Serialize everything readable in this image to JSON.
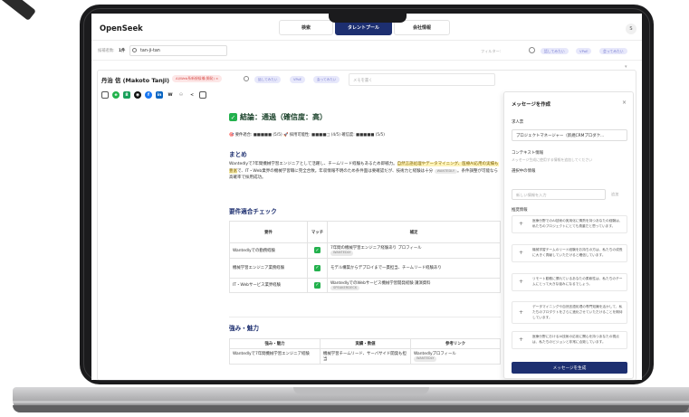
{
  "app": {
    "brand": "OpenSeek",
    "nav_tabs": [
      {
        "label": "検索",
        "active": false
      },
      {
        "label": "タレントプール",
        "active": true
      },
      {
        "label": "会社情報",
        "active": false
      }
    ],
    "avatar_initial": "S"
  },
  "search": {
    "label": "候補者数:",
    "count": "1件",
    "query": "tan-ji-tan",
    "filter_label": "フィルター:",
    "chips": [
      "話してみたい",
      "VPoE",
      "会ってみたい"
    ]
  },
  "candidate": {
    "name": "丹治 信 (Makoto Tanji)",
    "tag": "AI/Web系新規候補(開発) ×",
    "chips": [
      "話してみたい",
      "VPoE",
      "会ってみたい"
    ],
    "memo_placeholder": "メモを書く",
    "social_icons": [
      "chat-icon",
      "lapras-icon",
      "eight-icon",
      "github-icon",
      "facebook-icon",
      "linkedin-icon",
      "wantedly-icon",
      "people-icon",
      "share-icon",
      "archive-icon"
    ]
  },
  "report": {
    "verdict": "結論：通過（確信度：高）",
    "scores": "🎯 要件適合: ■■■■■ (5/5)  🚀 採用可能性: ■■■■□ (4/5) 確信度: ■■■■■ (5/5)",
    "summary_heading": "まとめ",
    "summary_part1": "Wantedlyで7年間機械学習エンジニアとして活躍し、チームリード経験もあるため即戦力。",
    "summary_highlight": "自然言語処理やデータマイニング、医療AI応用の実績も豊富",
    "summary_part2": "で、IT・Web業界の機械学習職に完全合致。年収情報不明のため条件面は要確認だが、技術力と経験は十分",
    "summary_pill": "WANTEDLY",
    "summary_part3": "。条件調整が可能なら高確率で採用成功。",
    "req_heading": "要件適合チェック",
    "req_columns": [
      "要件",
      "マッチ",
      "補足"
    ],
    "req_rows": [
      {
        "req": "Wantedlyでの勤務経験",
        "note": "7年間の機械学習エンジニア経験あり プロフィール",
        "pill": "WANTEDLY"
      },
      {
        "req": "機械学習エンジニア業務経験",
        "note": "モデル構築からデプロイまで一貫担当、チームリード経験あり",
        "pill": ""
      },
      {
        "req": "IT・Webサービス業界経験",
        "note": "WantedlyでのWebサービス機械学習開発経験 講演資料",
        "pill": "SPEAKERDECK"
      }
    ],
    "strengths_heading": "強み・魅力",
    "str_columns": [
      "強み・魅力",
      "実績・数値",
      "参考リンク"
    ],
    "str_rows": [
      {
        "strength": "Wantedlyで7年間機械学習エンジニア経験",
        "result": "機械学習チームリード、サーバサイド開発も担当",
        "link": "Wantedlyプロフィール",
        "pill": "WANTEDLY"
      }
    ]
  },
  "message_panel": {
    "title": "メッセージを作成",
    "job_label": "求人票",
    "job_value": "プロジェクトマネージャー（新規CRMプロダク...",
    "context_label": "コンテキスト情報",
    "context_hint": "メッセージ生成に使用する情報を追加してください",
    "selected_label": "選択中の情報",
    "input_placeholder": "新しい情報を入力",
    "add_label": "追加",
    "suggest_label": "推奨情報",
    "suggestions": [
      "医療分野でのAI技術の実用化に情熱を持つあなたの経験は、私たちのプロジェクトにとても貴重だと思っています。",
      "機械学習チームのリード経験をお持ちの方は、私たちの成長に大きく貢献していただけると確信しています。",
      "リモート勤務に慣れているあなたの柔軟性は、私たちのチームにとって大きな強みになるでしょう。",
      "データマイニングや自然言語処理の専門知識を活かして、私たちのプロダクトをさらに進化させていただけることを期待しています。",
      "医療分野におけるAI技術の応用に関心を持つあなたの視点は、私たちのビジョンと非常に合致しています。"
    ],
    "generate_label": "メッセージを生成"
  },
  "colors": {
    "primary": "#1d2f70",
    "success": "#23b14d",
    "highlight": "#fff4b8",
    "tag_red": "#d9534f",
    "chip_purple": "#7b7fd0"
  }
}
